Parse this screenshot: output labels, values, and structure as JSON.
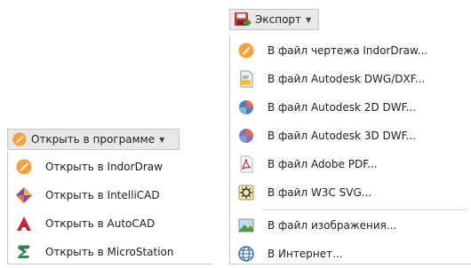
{
  "export_menu": {
    "button_label": "Экспорт",
    "items": [
      {
        "label": "В файл чертежа IndorDraw...",
        "icon": "indordraw-icon"
      },
      {
        "label": "В файл Autodesk DWG/DXF...",
        "icon": "dwg-file-icon"
      },
      {
        "label": "В файл Autodesk 2D DWF...",
        "icon": "dwf-2d-icon"
      },
      {
        "label": "В файл Autodesk 3D DWF...",
        "icon": "dwf-3d-icon"
      },
      {
        "label": "В файл Adobe PDF...",
        "icon": "pdf-icon"
      },
      {
        "label": "В файл W3C SVG...",
        "icon": "svg-icon"
      },
      {
        "label": "В файл изображения...",
        "icon": "image-file-icon"
      },
      {
        "label": "В Интернет...",
        "icon": "globe-icon"
      }
    ]
  },
  "open_menu": {
    "button_label": "Открыть в программе",
    "items": [
      {
        "label": "Открыть в IndorDraw",
        "icon": "indordraw-icon"
      },
      {
        "label": "Открыть в IntelliCAD",
        "icon": "intellicad-icon"
      },
      {
        "label": "Открыть в AutoCAD",
        "icon": "autocad-icon"
      },
      {
        "label": "Открыть в MicroStation",
        "icon": "microstation-icon"
      }
    ]
  },
  "colors": {
    "button_bg": "#e8e8e8",
    "border": "#c8c8c8",
    "accent_orange": "#f5a13a"
  }
}
